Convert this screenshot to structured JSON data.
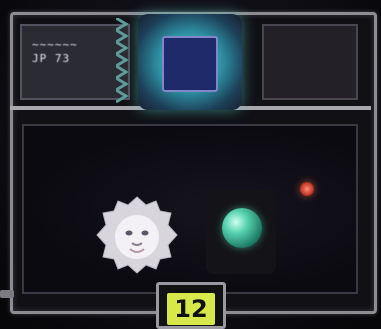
{
  "game": {
    "left_panel_text": "~~~~~~\nJP 73",
    "counter_value": "12"
  },
  "colors": {
    "frame": "#8e8c90",
    "center_glow": "#5fd9c9",
    "counter_bg": "#d6e84a",
    "orb": "#59d3b0",
    "red_light": "#c8402f"
  },
  "icons": {
    "lion": "lion-head-icon",
    "orb": "green-orb-icon"
  }
}
